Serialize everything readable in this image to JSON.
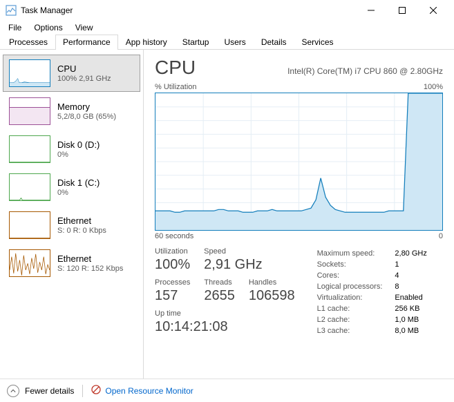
{
  "window": {
    "title": "Task Manager"
  },
  "menu": {
    "file": "File",
    "options": "Options",
    "view": "View"
  },
  "tabs": {
    "processes": "Processes",
    "performance": "Performance",
    "app_history": "App history",
    "startup": "Startup",
    "users": "Users",
    "details": "Details",
    "services": "Services"
  },
  "sidebar": {
    "cpu": {
      "name": "CPU",
      "sub": "100% 2,91 GHz"
    },
    "memory": {
      "name": "Memory",
      "sub": "5,2/8,0 GB (65%)"
    },
    "disk0": {
      "name": "Disk 0 (D:)",
      "sub": "0%"
    },
    "disk1": {
      "name": "Disk 1 (C:)",
      "sub": "0%"
    },
    "eth0": {
      "name": "Ethernet",
      "sub": "S: 0  R: 0 Kbps"
    },
    "eth1": {
      "name": "Ethernet",
      "sub": "S: 120 R: 152 Kbps"
    }
  },
  "detail": {
    "title": "CPU",
    "subtitle": "Intel(R) Core(TM) i7 CPU 860 @ 2.80GHz",
    "ylabel": "% Utilization",
    "ymax": "100%",
    "xlabel": "60 seconds",
    "xmax": "0"
  },
  "stats1": {
    "util_label": "Utilization",
    "util_val": "100%",
    "speed_label": "Speed",
    "speed_val": "2,91 GHz",
    "proc_label": "Processes",
    "proc_val": "157",
    "thr_label": "Threads",
    "thr_val": "2655",
    "hnd_label": "Handles",
    "hnd_val": "106598",
    "up_label": "Up time",
    "up_val": "10:14:21:08"
  },
  "stats2": {
    "maxspeed_l": "Maximum speed:",
    "maxspeed_v": "2,80 GHz",
    "sockets_l": "Sockets:",
    "sockets_v": "1",
    "cores_l": "Cores:",
    "cores_v": "4",
    "lproc_l": "Logical processors:",
    "lproc_v": "8",
    "virt_l": "Virtualization:",
    "virt_v": "Enabled",
    "l1_l": "L1 cache:",
    "l1_v": "256 KB",
    "l2_l": "L2 cache:",
    "l2_v": "1,0 MB",
    "l3_l": "L3 cache:",
    "l3_v": "8,0 MB"
  },
  "footer": {
    "fewer": "Fewer details",
    "orm": "Open Resource Monitor"
  },
  "chart_data": {
    "type": "line",
    "title": "CPU % Utilization",
    "xlabel": "seconds ago",
    "ylabel": "% Utilization",
    "ylim": [
      0,
      100
    ],
    "xlim_seconds": [
      60,
      0
    ],
    "values_pct": [
      14,
      14,
      14,
      14,
      13,
      13,
      14,
      14,
      14,
      14,
      14,
      14,
      14,
      15,
      15,
      14,
      14,
      14,
      13,
      13,
      13,
      14,
      14,
      14,
      15,
      14,
      14,
      14,
      14,
      14,
      14,
      15,
      16,
      22,
      38,
      24,
      18,
      15,
      14,
      13,
      13,
      13,
      13,
      13,
      13,
      13,
      13,
      13,
      14,
      14,
      14,
      14,
      100,
      100,
      100,
      100,
      100,
      100,
      100,
      100
    ]
  }
}
